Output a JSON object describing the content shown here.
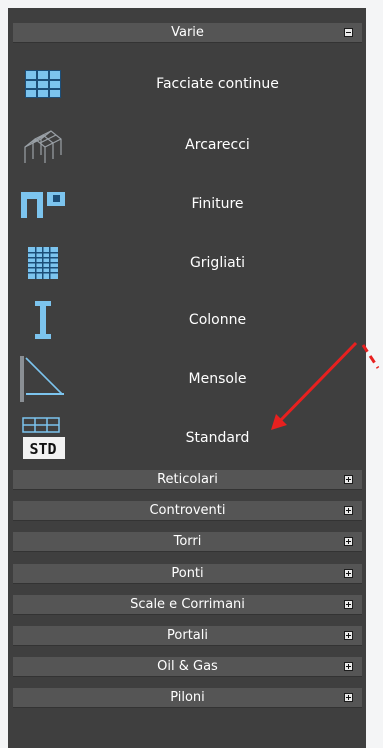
{
  "open_section": {
    "title": "Varie",
    "toggle_symbol": "−",
    "items": [
      {
        "label": "Facciate continue",
        "icon": "curtain-wall-icon"
      },
      {
        "label": "Arcarecci",
        "icon": "purlins-icon"
      },
      {
        "label": "Finiture",
        "icon": "finishes-icon"
      },
      {
        "label": "Grigliati",
        "icon": "grating-icon"
      },
      {
        "label": "Colonne",
        "icon": "column-icon"
      },
      {
        "label": "Mensole",
        "icon": "bracket-icon"
      },
      {
        "label": "Standard",
        "icon": "standard-std-icon",
        "icon_text": "STD"
      }
    ]
  },
  "collapsed_sections": [
    {
      "title": "Reticolari",
      "toggle_symbol": "+"
    },
    {
      "title": "Controventi",
      "toggle_symbol": "+"
    },
    {
      "title": "Torri",
      "toggle_symbol": "+"
    },
    {
      "title": "Ponti",
      "toggle_symbol": "+"
    },
    {
      "title": "Scale e Corrimani",
      "toggle_symbol": "+"
    },
    {
      "title": "Portali",
      "toggle_symbol": "+"
    },
    {
      "title": "Oil & Gas",
      "toggle_symbol": "+"
    },
    {
      "title": "Piloni",
      "toggle_symbol": "+"
    }
  ],
  "colors": {
    "panel_bg": "#3f3f3f",
    "header_bg": "#555555",
    "icon_blue": "#7cc4ee",
    "annotation_red": "#e8201f"
  }
}
